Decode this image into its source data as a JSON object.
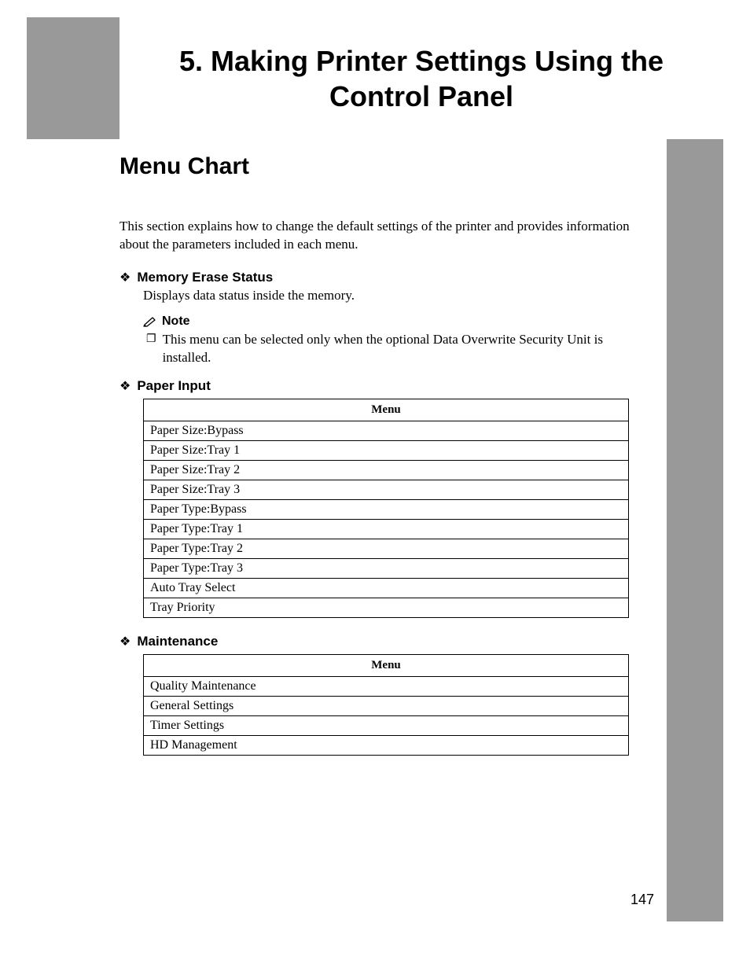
{
  "chapter": {
    "title": "5. Making Printer Settings Using the Control Panel"
  },
  "section": {
    "heading": "Menu Chart",
    "intro": "This section explains how to change the default settings of the printer and provides information about the parameters included in each menu."
  },
  "items": [
    {
      "title": "Memory Erase Status",
      "body": "Displays data status inside the memory.",
      "note": {
        "label": "Note",
        "text": "This menu can be selected only when the optional Data Overwrite Security Unit is installed."
      }
    },
    {
      "title": "Paper Input",
      "table_header": "Menu",
      "rows": [
        "Paper Size:Bypass",
        "Paper Size:Tray 1",
        "Paper Size:Tray 2",
        "Paper Size:Tray 3",
        "Paper Type:Bypass",
        "Paper Type:Tray 1",
        "Paper Type:Tray 2",
        "Paper Type:Tray 3",
        "Auto Tray Select",
        "Tray Priority"
      ]
    },
    {
      "title": "Maintenance",
      "table_header": "Menu",
      "rows": [
        "Quality Maintenance",
        "General Settings",
        "Timer Settings",
        "HD Management"
      ]
    }
  ],
  "page_number": "147"
}
